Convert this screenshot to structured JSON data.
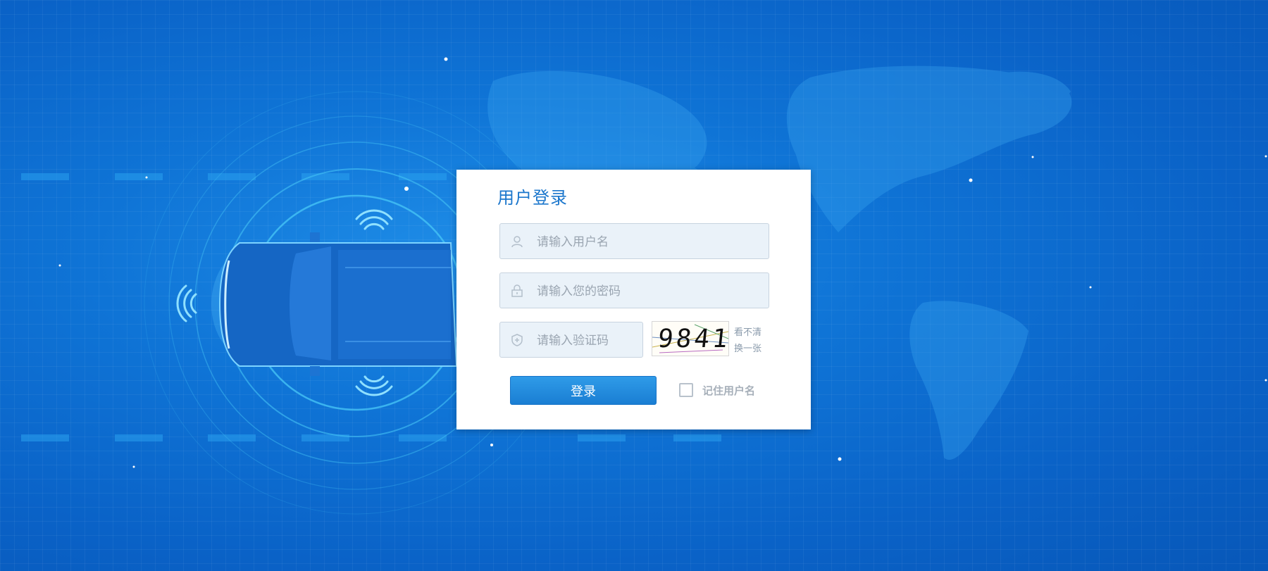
{
  "login": {
    "title": "用户登录",
    "username_placeholder": "请输入用户名",
    "password_placeholder": "请输入您的密码",
    "captcha_placeholder": "请输入验证码",
    "captcha_code": "9841",
    "captcha_unclear": "看不清",
    "captcha_refresh": "换一张",
    "submit_label": "登录",
    "remember_label": "记住用户名",
    "remember_checked": false
  },
  "icons": {
    "username": "user-icon",
    "password": "lock-icon",
    "captcha": "shield-icon"
  },
  "colors": {
    "accent": "#1a7ed3",
    "title": "#1a76cc",
    "background": "#0f74d6"
  }
}
